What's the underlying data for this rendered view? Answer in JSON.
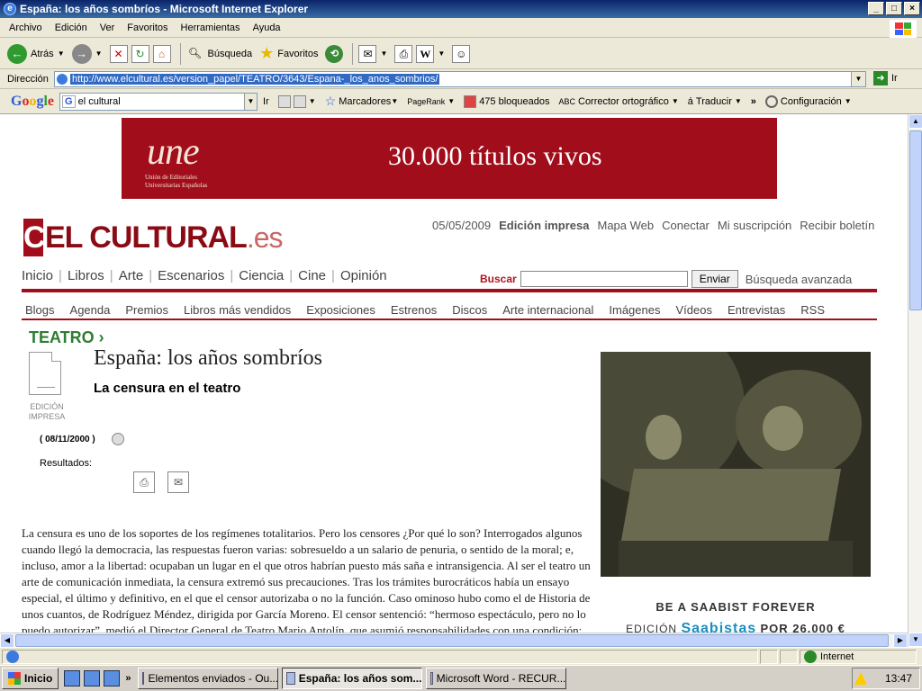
{
  "window": {
    "title": "España: los años sombríos - Microsoft Internet Explorer"
  },
  "menubar": {
    "items": [
      "Archivo",
      "Edición",
      "Ver",
      "Favoritos",
      "Herramientas",
      "Ayuda"
    ]
  },
  "toolbar": {
    "back": "Atrás",
    "search": "Búsqueda",
    "favorites": "Favoritos"
  },
  "addressbar": {
    "label": "Dirección",
    "url": "http://www.elcultural.es/version_papel/TEATRO/3643/Espana-_los_anos_sombrios/",
    "go": "Ir"
  },
  "googlebar": {
    "logo": "Google",
    "query": "el cultural",
    "go": "Ir",
    "bookmarks": "Marcadores",
    "pagerank": "PageRank",
    "blocked": "475 bloqueados",
    "spell": "Corrector ortográfico",
    "translate": "Traducir",
    "config": "Configuración"
  },
  "banner": {
    "logo": "une",
    "logo_line1": "Unión de Editoriales",
    "logo_line2": "Universitarias Españolas",
    "slogan": "30.000 títulos vivos"
  },
  "site": {
    "logo_name": "EL CULTURAL",
    "logo_ext": ".es",
    "date": "05/05/2009",
    "toplinks": [
      "Edición impresa",
      "Mapa Web",
      "Conectar",
      "Mi suscripción",
      "Recibir boletín"
    ],
    "mainnav": [
      "Inicio",
      "Libros",
      "Arte",
      "Escenarios",
      "Ciencia",
      "Cine",
      "Opinión"
    ],
    "search_label": "Buscar",
    "search_button": "Enviar",
    "advanced_search": "Búsqueda avanzada",
    "subnav": [
      "Blogs",
      "Agenda",
      "Premios",
      "Libros más vendidos",
      "Exposiciones",
      "Estrenos",
      "Discos",
      "Arte internacional",
      "Imágenes",
      "Vídeos",
      "Entrevistas",
      "RSS"
    ]
  },
  "article": {
    "section": "TEATRO ›",
    "edition_label_1": "EDICIÓN",
    "edition_label_2": "IMPRESA",
    "title": "España: los años sombríos",
    "subtitle": "La censura en el teatro",
    "date": "( 08/11/2000 )",
    "results_label": "Resultados:",
    "body": "La censura es uno de los soportes de los regímenes totalitarios. Pero los censores ¿Por qué lo son? Interrogados algunos cuando llegó la democracia, las respuestas fueron varias: sobresueldo a un salario de penuria, o sentido de la moral; e, incluso, amor a la libertad: ocupaban un lugar en el que otros habrían puesto más saña e intransigencia. Al ser el teatro un arte de comunicación inmediata, la censura extremó sus precauciones. Tras los trámites burocráticos había un ensayo especial, el último y definitivo, en el que el censor autorizaba o no la función. Caso ominoso hubo como el de Historia de unos cuantos, de Rodríguez Méndez, dirigida por García Moreno. El censor sentenció: “hermoso espectáculo, pero no lo puedo autorizar”, medió el Director General de Teatro Mario Antolín, que asumió responsabilidades con una condición: que no apareciera la"
  },
  "sidead": {
    "line1": "BE A SAABIST FOREVER",
    "edition": "EDICIÓN",
    "brand": "Saabistas",
    "price": "POR 26.000 €"
  },
  "statusbar": {
    "zone": "Internet"
  },
  "taskbar": {
    "start": "Inicio",
    "tasks": [
      "Elementos enviados - Ou...",
      "España: los años som...",
      "Microsoft Word - RECUR..."
    ],
    "clock": "13:47"
  }
}
